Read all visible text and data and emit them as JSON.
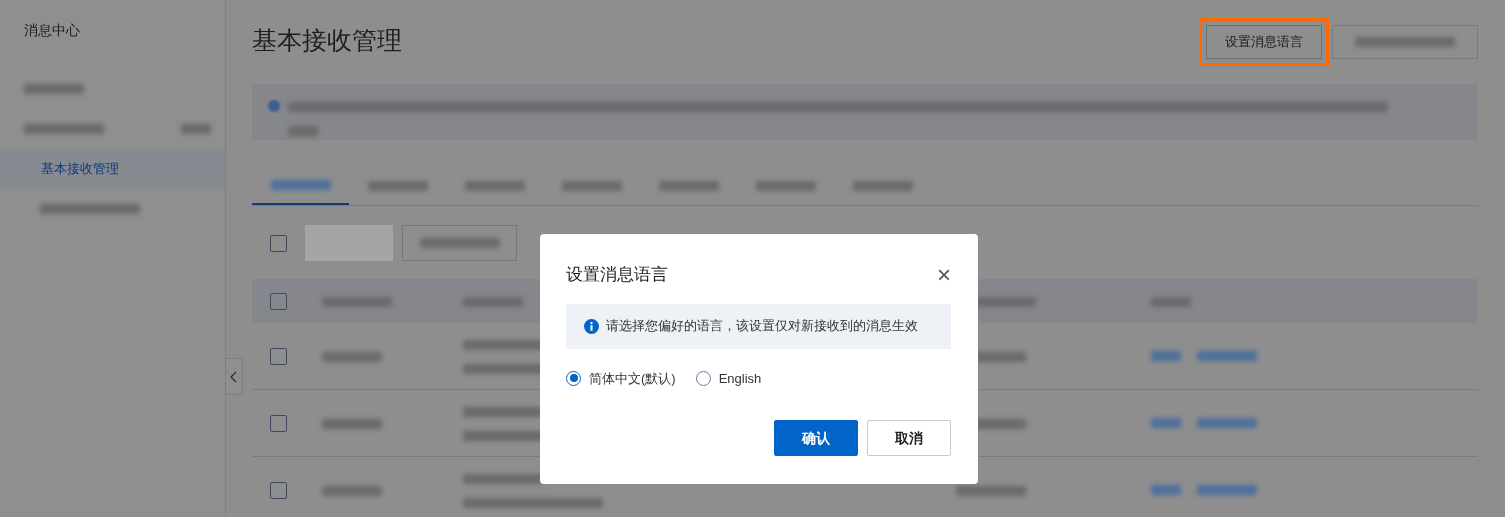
{
  "sidebar": {
    "title": "消息中心",
    "items": [
      {
        "label": "基本接收管理",
        "selected": true
      }
    ]
  },
  "page": {
    "title": "基本接收管理",
    "header_button": {
      "label": "设置消息语言",
      "highlighted": true
    }
  },
  "tabs": [
    {
      "selected": true
    },
    {
      "selected": false
    },
    {
      "selected": false
    },
    {
      "selected": false
    },
    {
      "selected": false
    },
    {
      "selected": false
    },
    {
      "selected": false
    }
  ],
  "toolbar": {
    "checked": false
  },
  "table": {
    "header_checked": false,
    "rows": [
      {
        "checked": false
      },
      {
        "checked": false
      },
      {
        "checked": false
      }
    ]
  },
  "dialog": {
    "title": "设置消息语言",
    "close": "×",
    "notice": "请选择您偏好的语言，该设置仅对新接收到的消息生效",
    "options": [
      {
        "label": "简体中文(默认)",
        "selected": true
      },
      {
        "label": "English",
        "selected": false
      }
    ],
    "buttons": [
      {
        "label": "确认",
        "kind": "primary"
      },
      {
        "label": "取消",
        "kind": "default"
      }
    ]
  }
}
